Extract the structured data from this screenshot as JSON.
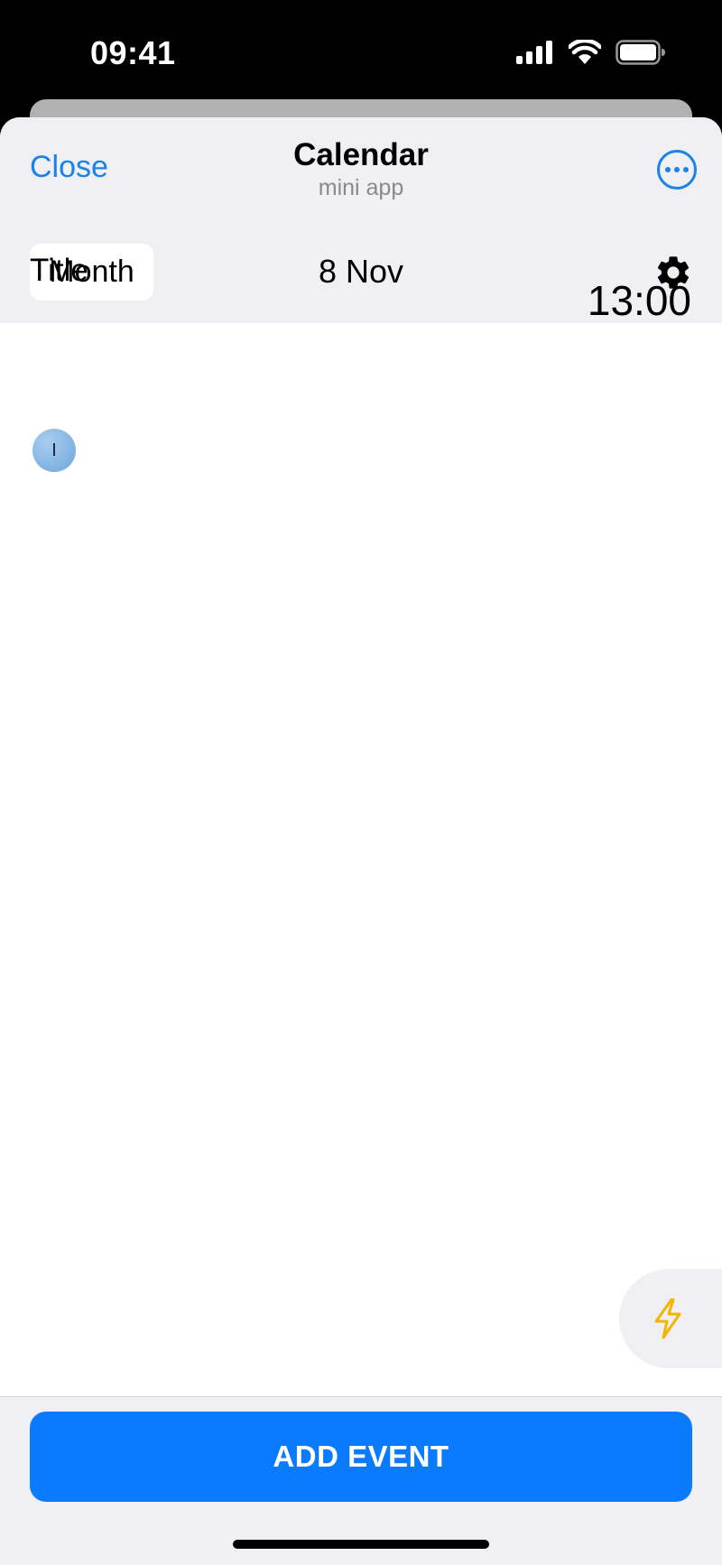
{
  "status_bar": {
    "time": "09:41",
    "icons": [
      "cellular-signal-icon",
      "wifi-icon",
      "battery-icon"
    ]
  },
  "header": {
    "close_label": "Close",
    "title": "Calendar",
    "subtitle": "mini app",
    "more_icon": "ellipsis-circle-icon"
  },
  "toolbar": {
    "view_mode": "Month",
    "date": "8 Nov",
    "settings_icon": "gear-icon"
  },
  "events": [
    {
      "title": "Title",
      "avatar_initial": "I",
      "time": "13:00"
    }
  ],
  "floating_action": {
    "icon": "lightning-icon"
  },
  "footer": {
    "add_event_label": "ADD EVENT"
  },
  "colors": {
    "accent": "#1a82e8",
    "primary_button": "#0a7bff",
    "header_bg": "#efeff4",
    "lightning": "#f5b400"
  }
}
